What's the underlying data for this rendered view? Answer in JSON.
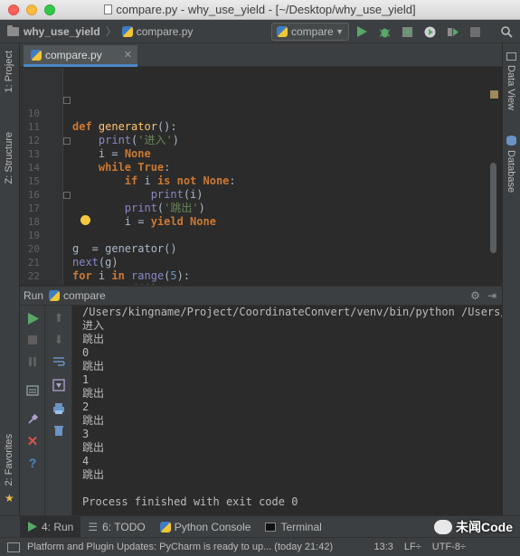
{
  "window": {
    "title": "compare.py - why_use_yield - [~/Desktop/why_use_yield]"
  },
  "toolbar": {
    "project_name": "why_use_yield",
    "file_name": "compare.py",
    "run_config": "compare"
  },
  "sidebar_left": {
    "project_tab": "1: Project",
    "structure_tab": "Z: Structure",
    "favorites_tab": "2: Favorites"
  },
  "sidebar_right": {
    "dataview_tab": "Data View",
    "database_tab": "Database"
  },
  "editor": {
    "tab_label": "compare.py",
    "line_numbers": [
      "10",
      "11",
      "12",
      "13",
      "14",
      "15",
      "16",
      "17",
      "18",
      "19",
      "20",
      "21",
      "22",
      "23"
    ]
  },
  "run_panel": {
    "title": "Run",
    "config": "compare",
    "console": [
      "/Users/kingname/Project/CoordinateConvert/venv/bin/python /Users/k",
      "进入",
      "跳出",
      "0",
      "跳出",
      "1",
      "跳出",
      "2",
      "跳出",
      "3",
      "跳出",
      "4",
      "跳出",
      "",
      "Process finished with exit code 0"
    ]
  },
  "bottom_tabs": {
    "run": "4: Run",
    "todo": "6: TODO",
    "python_console": "Python Console",
    "terminal": "Terminal"
  },
  "status_bar": {
    "message": "Platform and Plugin Updates: PyCharm is ready to up... (today 21:42)",
    "position": "13:3",
    "line_sep": "LF÷",
    "encoding": "UTF-8÷"
  },
  "watermark": {
    "text": "未闻Code"
  },
  "colors": {
    "keyword": "#cc7832",
    "function": "#ffc66d",
    "string": "#6a8759",
    "number": "#6897bb",
    "builtin": "#8888c6",
    "accent": "#4a88c7"
  }
}
